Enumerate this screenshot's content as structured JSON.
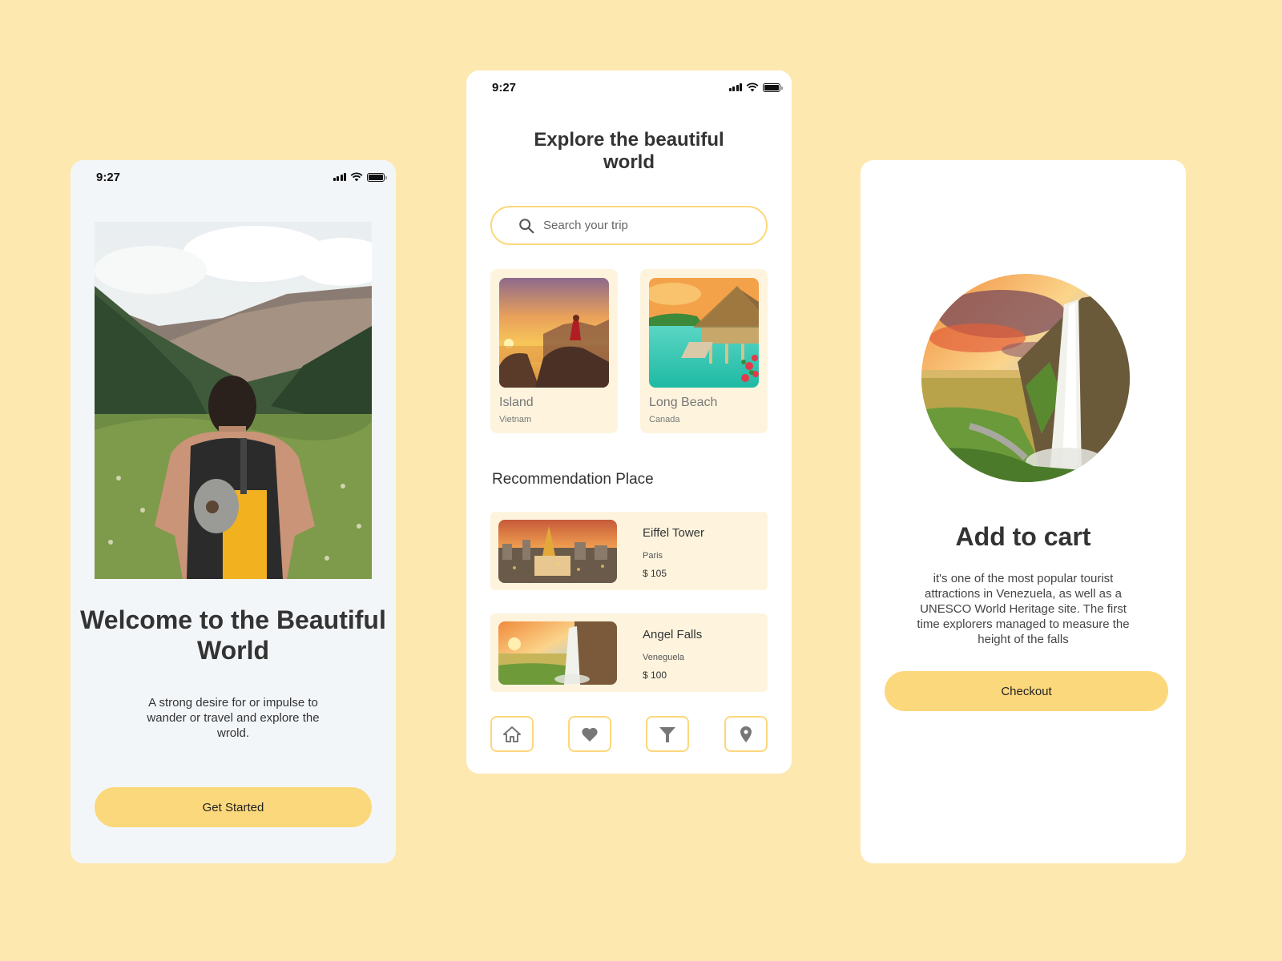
{
  "background_color": "#fde8b0",
  "accent_color": "#fcd87c",
  "card_color": "#fef4de",
  "welcome_screen": {
    "status_time": "9:27",
    "hero_image": "hiker-with-backpack-in-mountain-valley",
    "title": "Welcome to the Beautiful World",
    "description": "A strong desire for or impulse to wander or travel and explore the wrold.",
    "cta_label": "Get Started"
  },
  "explore_screen": {
    "status_time": "9:27",
    "title": "Explore the beautiful world",
    "search": {
      "placeholder": "Search your trip",
      "value": "",
      "icon": "search-icon"
    },
    "places": [
      {
        "name": "Island",
        "country": "Vietnam",
        "image": "person-on-rock-at-sunset"
      },
      {
        "name": "Long Beach",
        "country": "Canada",
        "image": "overwater-bungalow-turquoise-sea"
      }
    ],
    "recommendation_title": "Recommendation Place",
    "recommendations": [
      {
        "name": "Eiffel Tower",
        "city": "Paris",
        "price": "$ 105",
        "image": "city-skyline-at-sunset"
      },
      {
        "name": "Angel Falls",
        "city": "Veneguela",
        "price": "$ 100",
        "image": "waterfall-at-sunset"
      }
    ],
    "nav": [
      {
        "id": "home",
        "icon": "home-icon"
      },
      {
        "id": "favorites",
        "icon": "heart-icon"
      },
      {
        "id": "filter",
        "icon": "filter-icon"
      },
      {
        "id": "location",
        "icon": "location-pin-icon"
      }
    ]
  },
  "cart_screen": {
    "hero_image": "waterfall-at-sunset",
    "title": "Add to cart",
    "description": "it's one of the most popular tourist attractions in Venezuela, as well as a UNESCO World Heritage site. The first time explorers managed to measure the height of the falls",
    "cta_label": "Checkout"
  }
}
